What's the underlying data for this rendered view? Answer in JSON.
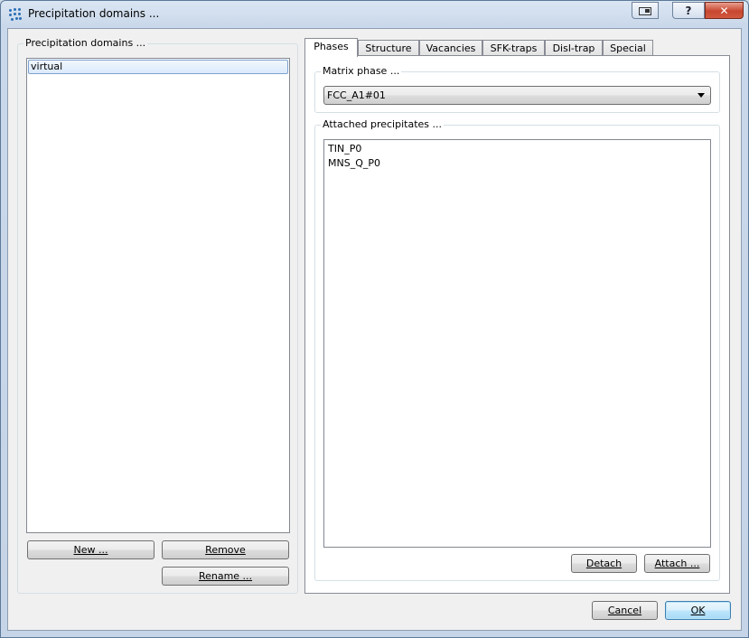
{
  "window": {
    "title": "Precipitation domains ...",
    "help_label": "?",
    "close_label": "✕"
  },
  "domains_group": {
    "title": "Precipitation domains ...",
    "items": [
      "virtual"
    ],
    "new_label": "New ...",
    "remove_label": "Remove",
    "rename_label": "Rename ..."
  },
  "tabs": [
    "Phases",
    "Structure",
    "Vacancies",
    "SFK-traps",
    "Disl-trap",
    "Special"
  ],
  "matrix": {
    "title": "Matrix phase ...",
    "value": "FCC_A1#01"
  },
  "attached": {
    "title": "Attached precipitates ...",
    "items": [
      "TIN_P0",
      "MNS_Q_P0"
    ],
    "detach_label": "Detach",
    "attach_label": "Attach ..."
  },
  "footer": {
    "cancel_label": "Cancel",
    "ok_label": "OK"
  },
  "colors": {
    "accent": "#3c7fb1",
    "close": "#c8462f",
    "frame": "#c5d4e6"
  }
}
